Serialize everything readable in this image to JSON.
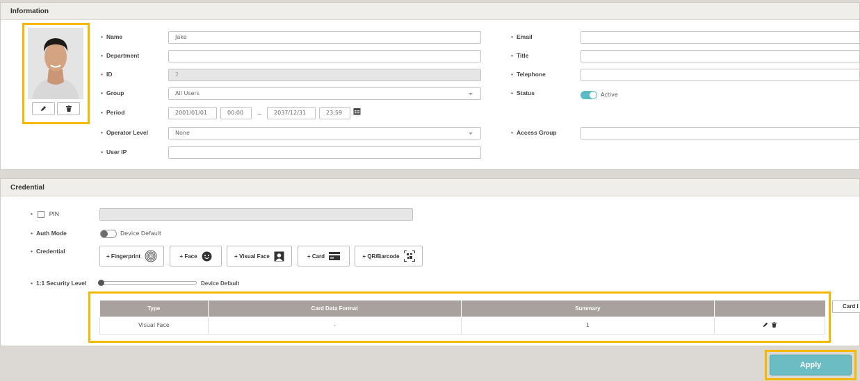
{
  "info": {
    "header": "Information",
    "fields": {
      "name": {
        "label": "Name",
        "value": "Jake"
      },
      "department": {
        "label": "Department",
        "value": ""
      },
      "id": {
        "label": "ID",
        "value": "2"
      },
      "group": {
        "label": "Group",
        "value": "All Users"
      },
      "period": {
        "label": "Period",
        "start_date": "2001/01/01",
        "start_time": "00:00",
        "separator": "~",
        "end_date": "2037/12/31",
        "end_time": "23:59"
      },
      "operator_level": {
        "label": "Operator Level",
        "value": "None"
      },
      "user_ip": {
        "label": "User IP",
        "value": ""
      },
      "email": {
        "label": "Email",
        "value": ""
      },
      "title": {
        "label": "Title",
        "value": ""
      },
      "telephone": {
        "label": "Telephone",
        "value": ""
      },
      "status": {
        "label": "Status",
        "value": "Active"
      },
      "access_group": {
        "label": "Access Group",
        "value": ""
      }
    },
    "photo": {
      "edit_icon": "pencil-icon",
      "delete_icon": "trash-icon"
    }
  },
  "credential": {
    "header": "Credential",
    "pin": {
      "label": "PIN",
      "checked": false
    },
    "auth_mode": {
      "label": "Auth Mode",
      "value": "Device Default"
    },
    "credential_label": "Credential",
    "buttons": {
      "fingerprint": "+ Fingerprint",
      "face": "+ Face",
      "visual_face": "+ Visual Face",
      "card": "+ Card",
      "qr": "+ QR/Barcode"
    },
    "security_level": {
      "label": "1:1 Security Level",
      "value": "Device Default"
    },
    "table": {
      "columns": [
        "Type",
        "Card Data Format",
        "Summary",
        ""
      ],
      "rows": [
        {
          "type": "Visual Face",
          "format": "-",
          "summary": "1"
        }
      ]
    },
    "card_button": "Card I"
  },
  "footer": {
    "apply": "Apply"
  },
  "colors": {
    "accent": "#6bbdc3",
    "highlight": "#f5b800",
    "table_header": "#a9a19e"
  }
}
